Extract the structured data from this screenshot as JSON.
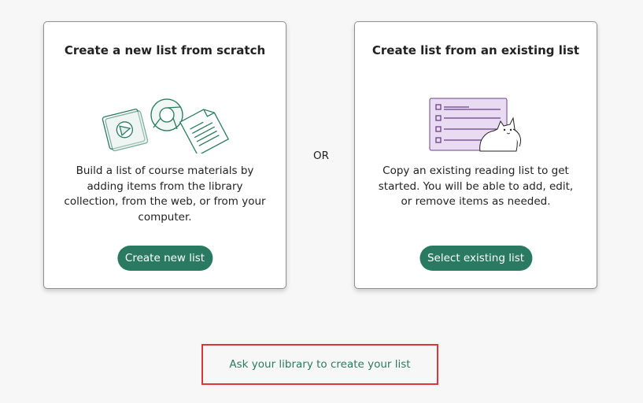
{
  "left_card": {
    "title": "Create a new list from scratch",
    "description": "Build a list of course materials by adding items from the library collection, from the web, or from your computer.",
    "button_label": "Create new list",
    "illustration": "media-web-document-icons"
  },
  "separator": "OR",
  "right_card": {
    "title": "Create list from an existing list",
    "description": "Copy an existing reading list to get started. You will be able to add, edit, or remove items as needed.",
    "button_label": "Select existing list",
    "illustration": "checklist-with-cat"
  },
  "ask_link": "Ask your library to create your list",
  "colors": {
    "accent": "#2a7a62",
    "highlight_border": "#e0343b",
    "illustration_purple": "#e9dcf2",
    "illustration_line": "#6b3f86"
  }
}
